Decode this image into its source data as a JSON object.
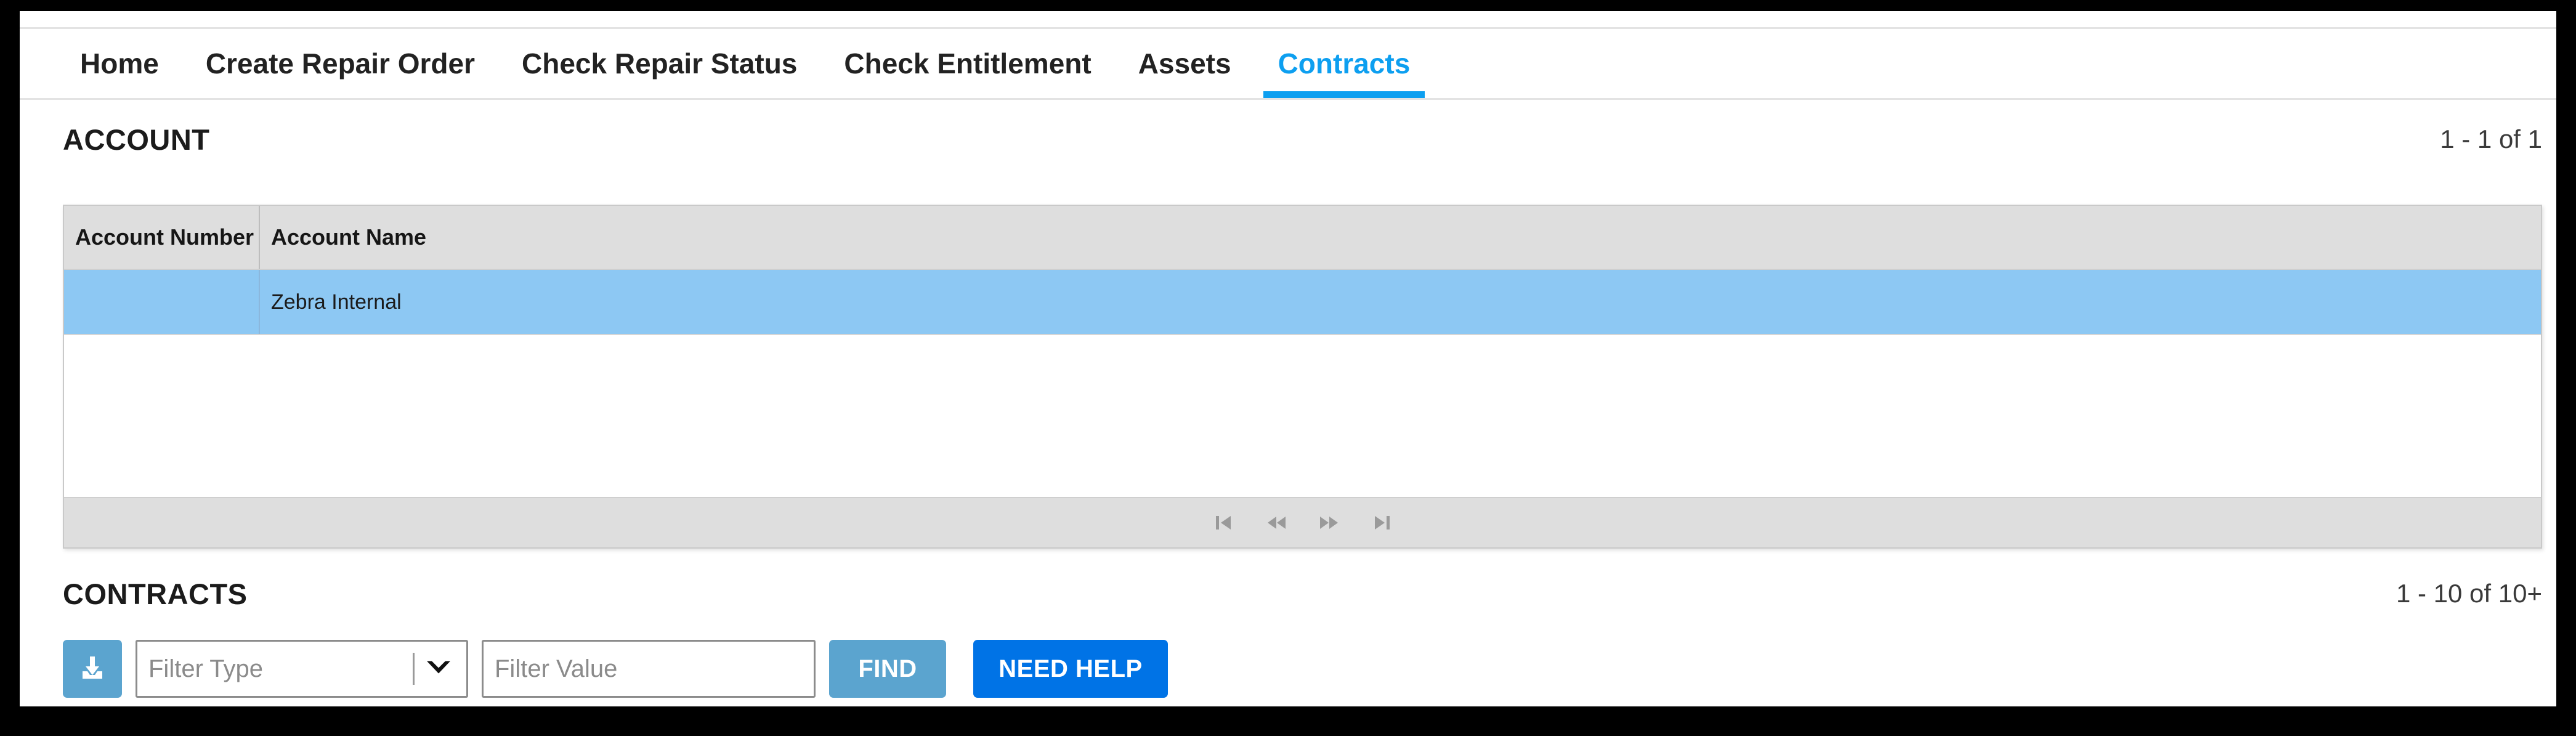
{
  "nav": {
    "tabs": [
      {
        "label": "Home",
        "active": false
      },
      {
        "label": "Create Repair Order",
        "active": false
      },
      {
        "label": "Check Repair Status",
        "active": false
      },
      {
        "label": "Check Entitlement",
        "active": false
      },
      {
        "label": "Assets",
        "active": false
      },
      {
        "label": "Contracts",
        "active": true
      }
    ],
    "active_color": "#0d9ff0"
  },
  "account_section": {
    "title": "ACCOUNT",
    "count": "1 - 1 of 1",
    "columns": [
      "Account Number",
      "Account Name"
    ],
    "rows": [
      {
        "account_number": "",
        "account_name": "Zebra Internal",
        "selected": true
      }
    ],
    "row_selected_color": "#8dc8f3",
    "pagination": [
      {
        "name": "first-page-button",
        "glyph": "first"
      },
      {
        "name": "previous-page-button",
        "glyph": "previous"
      },
      {
        "name": "next-page-button",
        "glyph": "next"
      },
      {
        "name": "last-page-button",
        "glyph": "last"
      }
    ]
  },
  "contracts_section": {
    "title": "CONTRACTS",
    "count": "1 - 10 of 10+",
    "toolbar": {
      "export_icon": "download-icon",
      "filter_type_placeholder": "Filter Type",
      "filter_type_value": "",
      "filter_value_placeholder": "Filter Value",
      "filter_value_value": "",
      "find_label": "FIND",
      "need_help_label": "NEED HELP",
      "find_color": "#5ba4cf",
      "need_help_color": "#0073e6",
      "export_color": "#5ba4cf"
    }
  }
}
